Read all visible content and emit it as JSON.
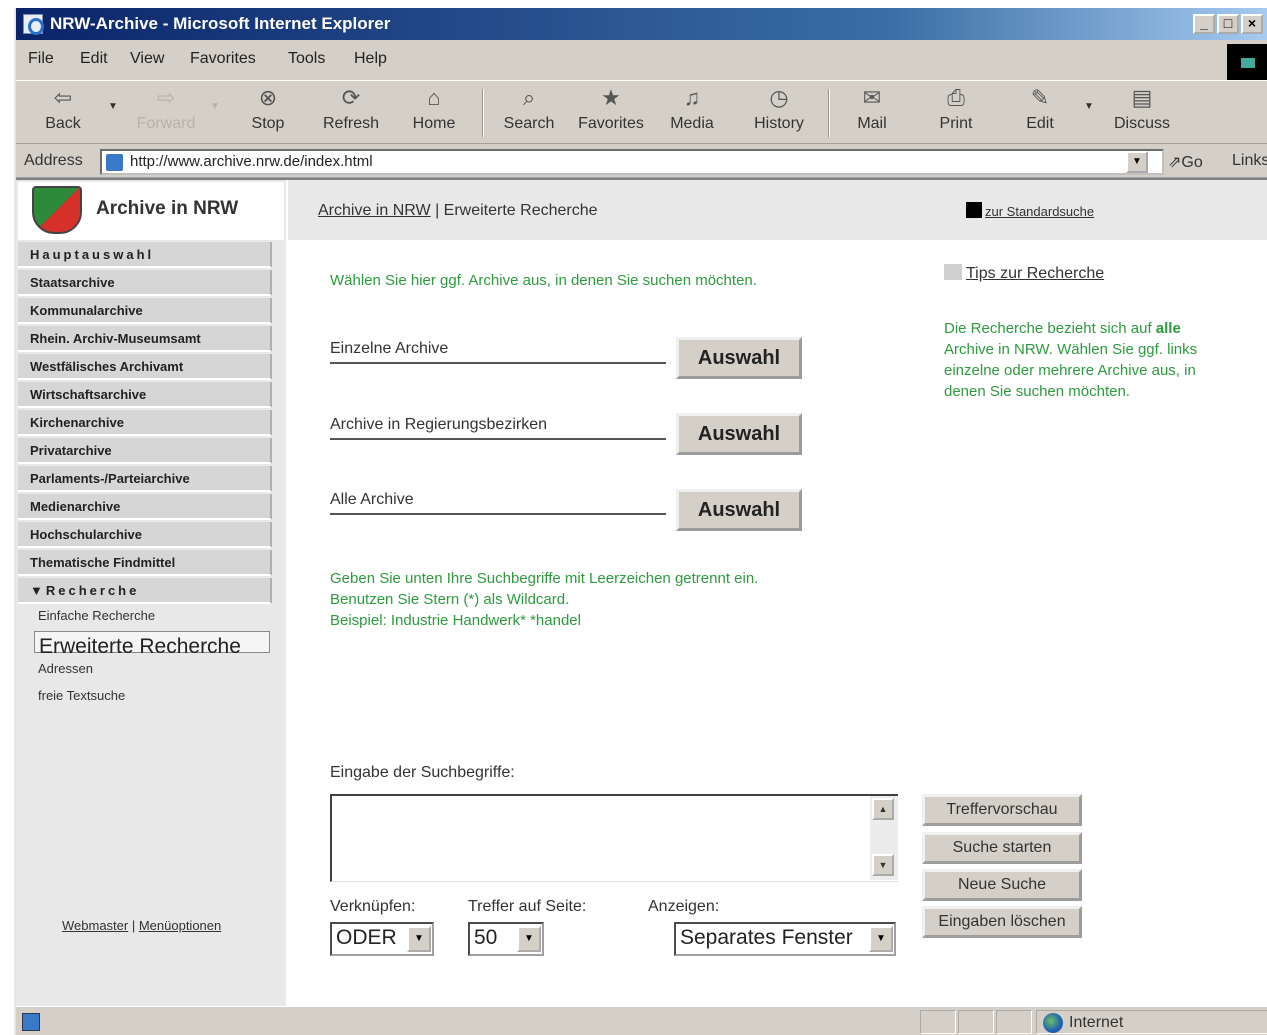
{
  "window": {
    "title": "NRW-Archive - Microsoft Internet Explorer"
  },
  "menu": [
    "File",
    "Edit",
    "View",
    "Favorites",
    "Tools",
    "Help"
  ],
  "toolbar": {
    "back": "Back",
    "forward": "Forward",
    "stop": "Stop",
    "refresh": "Refresh",
    "home": "Home",
    "search": "Search",
    "favorites": "Favorites",
    "media": "Media",
    "history": "History",
    "mail": "Mail",
    "print": "Print",
    "edit": "Edit",
    "discuss": "Discuss"
  },
  "address": {
    "label": "Address",
    "url": "http://www.archive.nrw.de/index.html",
    "go": "Go",
    "links": "Links"
  },
  "sidebar": {
    "logo_text": "Archive in NRW",
    "items": [
      "Hauptauswahl",
      "Staatsarchive",
      "Kommunalarchive",
      "Rhein. Archiv-Museumsamt",
      "Westfälisches Archivamt",
      "Wirtschaftsarchive",
      "Kirchenarchive",
      "Privatarchive",
      "Parlaments-/Parteiarchive",
      "Medienarchive",
      "Hochschularchive",
      "Thematische Findmittel"
    ],
    "recherche": "▼Recherche",
    "sub_items": [
      "Einfache Recherche",
      "Erweiterte Recherche",
      "Adressen",
      "freie Textsuche"
    ],
    "footer_webmaster": "Webmaster",
    "footer_sep": " | ",
    "footer_menu": "Menüoptionen"
  },
  "header": {
    "breadcrumb_link": "Archive in NRW",
    "breadcrumb_rest": " | Erweiterte Recherche",
    "standard": "zur Standardsuche"
  },
  "main": {
    "intro": "Wählen Sie hier ggf. Archive aus, in denen Sie suchen möchten.",
    "rows": [
      {
        "label": "Einzelne Archive",
        "button": "Auswahl"
      },
      {
        "label": "Archive in Regierungsbezirken",
        "button": "Auswahl"
      },
      {
        "label": "Alle Archive",
        "button": "Auswahl"
      }
    ],
    "help1": "Geben Sie unten Ihre Suchbegriffe mit Leerzeichen getrennt ein. Benutzen Sie Stern (*) als Wildcard.",
    "help2": "Beispiel: Industrie Handwerk* *handel",
    "search_label": "Eingabe der Suchbegriffe:",
    "search_value": "",
    "buttons": [
      "Treffervorschau",
      "Suche starten",
      "Neue Suche",
      "Eingaben löschen"
    ],
    "fields": {
      "verknuepfen_label": "Verknüpfen:",
      "verknuepfen_value": "ODER",
      "treffer_label": "Treffer auf Seite:",
      "treffer_value": "50",
      "anzeigen_label": "Anzeigen:",
      "anzeigen_value": "Separates Fenster"
    }
  },
  "right": {
    "tips": "Tips zur Recherche",
    "note_pre": "Die Recherche bezieht sich auf ",
    "note_bold": "alle",
    "note_post": " Archive in NRW. Wählen Sie ggf. links einzelne oder mehrere Archive aus, in denen Sie suchen möchten."
  },
  "status": {
    "zone": "Internet"
  },
  "colors": {
    "accent_green": "#2d9a3e",
    "title_blue": "#0a246a"
  }
}
